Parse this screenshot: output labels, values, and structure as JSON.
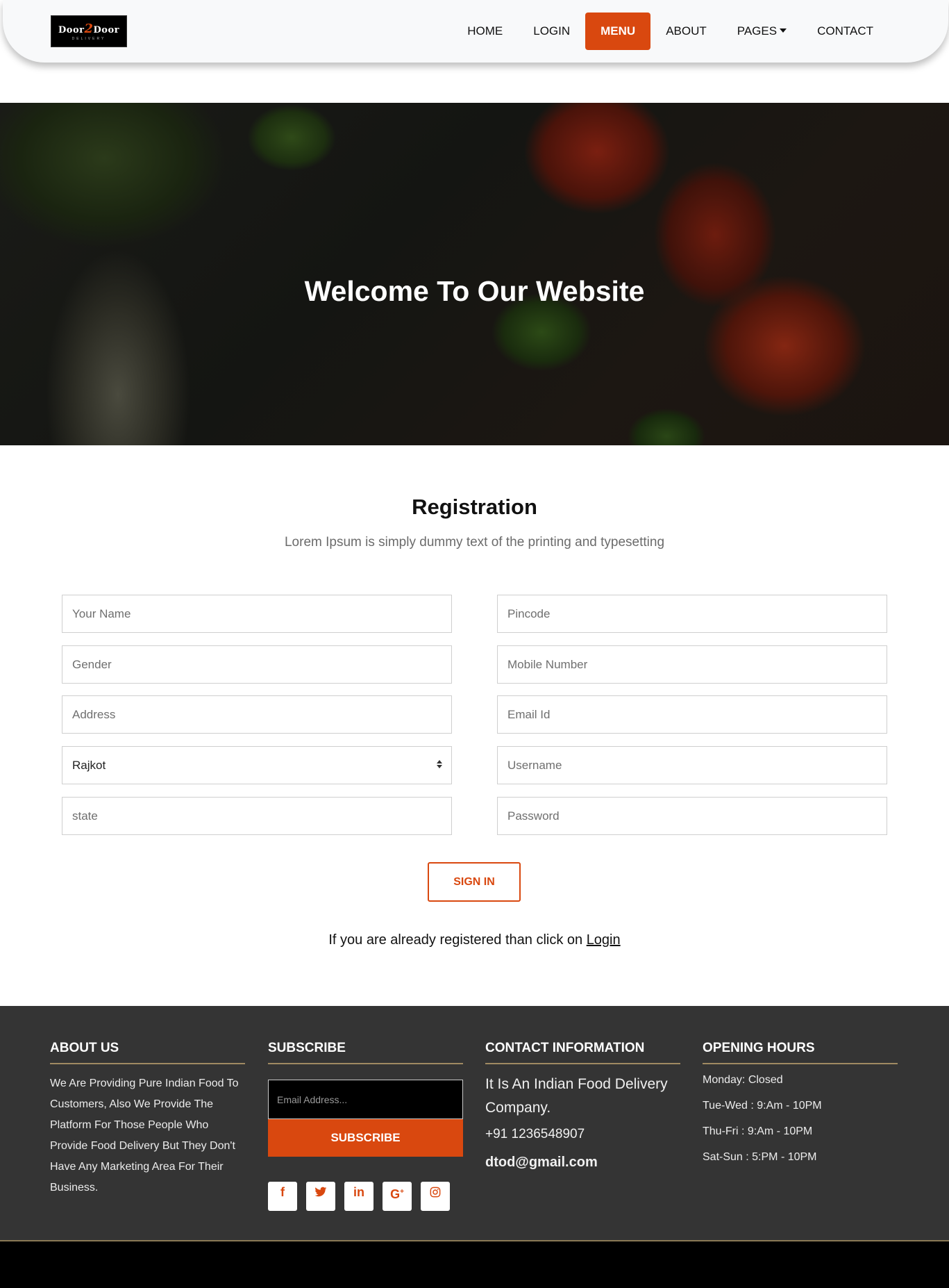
{
  "nav": {
    "logo_text": "Door2Door",
    "logo_sub": "DELIVERY",
    "items": [
      {
        "label": "HOME"
      },
      {
        "label": "LOGIN"
      },
      {
        "label": "MENU"
      },
      {
        "label": "ABOUT"
      },
      {
        "label": "PAGES"
      },
      {
        "label": "CONTACT"
      }
    ],
    "active": "MENU"
  },
  "hero": {
    "title": "Welcome To Our Website"
  },
  "registration": {
    "title": "Registration",
    "subtitle": "Lorem Ipsum is simply dummy text of the printing and typesetting",
    "fields_left": {
      "name": "Your Name",
      "gender": "Gender",
      "address": "Address",
      "city_selected": "Rajkot",
      "state": "state"
    },
    "fields_right": {
      "pincode": "Pincode",
      "mobile": "Mobile Number",
      "email": "Email Id",
      "username": "Username",
      "password": "Password"
    },
    "signin_label": "SIGN IN",
    "already_text": "If you are already registered than click on ",
    "login_link": "Login"
  },
  "footer": {
    "about": {
      "heading": "ABOUT US",
      "text": "We Are Providing Pure Indian Food To Customers, Also We Provide The Platform For Those People Who Provide Food Delivery But They Don't Have Any Marketing Area For Their Business."
    },
    "subscribe": {
      "heading": "SUBSCRIBE",
      "placeholder": "Email Address...",
      "button": "SUBSCRIBE",
      "social_icons": [
        "facebook-icon",
        "twitter-icon",
        "linkedin-icon",
        "google-plus-icon",
        "instagram-icon"
      ]
    },
    "contact": {
      "heading": "CONTACT INFORMATION",
      "description": "It Is An Indian Food Delivery Company.",
      "phone": "+91 1236548907",
      "email": "dtod@gmail.com"
    },
    "hours": {
      "heading": "OPENING HOURS",
      "rows": [
        "Monday: Closed",
        "Tue-Wed : 9:Am - 10PM",
        "Thu-Fri : 9:Am - 10PM",
        "Sat-Sun : 5:PM - 10PM"
      ]
    }
  },
  "colors": {
    "accent": "#d9480f",
    "footer_bg": "#343434",
    "navbar_bg": "#f8f9fa"
  }
}
